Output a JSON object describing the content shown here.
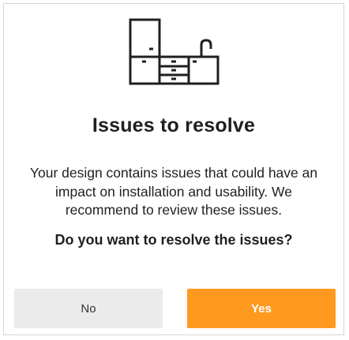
{
  "dialog": {
    "icon": "kitchen-cabinets-icon",
    "title": "Issues to resolve",
    "message": "Your design contains issues that could have an impact on installation and usability. We recommend to review these issues.",
    "question": "Do you want to resolve the issues?"
  },
  "buttons": {
    "no_label": "No",
    "yes_label": "Yes"
  },
  "colors": {
    "accent": "#ff9a1f",
    "secondary_button": "#ebebeb",
    "text": "#1f1f1f",
    "border": "#d6d6d6"
  }
}
